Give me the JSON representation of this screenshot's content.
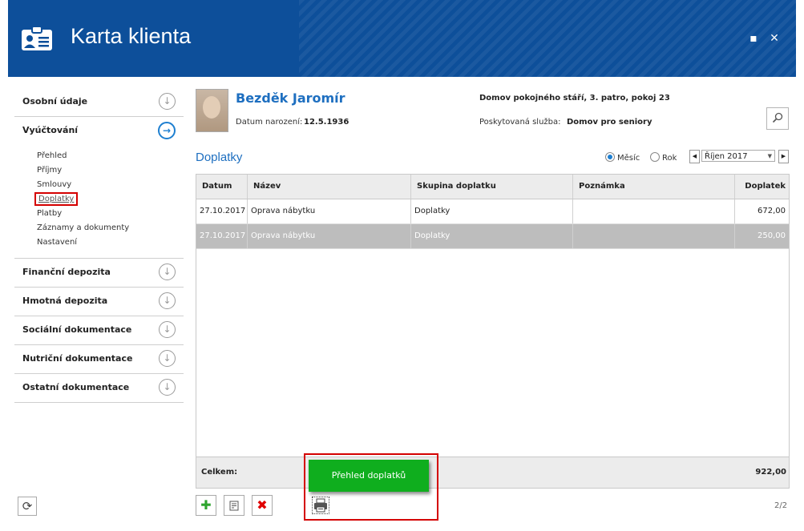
{
  "window": {
    "title": "Karta klienta",
    "maximize_glyph": "▪",
    "close_glyph": "✕"
  },
  "sidebar": {
    "sections": [
      {
        "label": "Osobní údaje",
        "icon": "arrow-down-circle-icon"
      },
      {
        "label": "Vyúčtování",
        "icon": "arrow-right-circle-icon",
        "active": true
      },
      {
        "label": "Finanční depozita",
        "icon": "arrow-down-circle-icon"
      },
      {
        "label": "Hmotná depozita",
        "icon": "arrow-down-circle-icon"
      },
      {
        "label": "Sociální dokumentace",
        "icon": "arrow-down-circle-icon"
      },
      {
        "label": "Nutriční dokumentace",
        "icon": "arrow-down-circle-icon"
      },
      {
        "label": "Ostatní dokumentace",
        "icon": "arrow-down-circle-icon"
      }
    ],
    "subitems": [
      "Přehled",
      "Příjmy",
      "Smlouvy",
      "Doplatky",
      "Platby",
      "Záznamy a dokumenty",
      "Nastavení"
    ],
    "selected_subitem": "Doplatky"
  },
  "client": {
    "name": "Bezděk Jaromír",
    "dob_label": "Datum narození:",
    "dob_value": "12.5.1936",
    "home": "Domov pokojného stáří, 3. patro, pokoj 23",
    "service_label": "Poskytovaná služba:",
    "service_value": "Domov pro seniory"
  },
  "section": {
    "title": "Doplatky",
    "radio_month": "Měsíc",
    "radio_year": "Rok",
    "radio_selected": "Měsíc",
    "period_value": "Říjen 2017",
    "prev_glyph": "◀",
    "next_glyph": "▶",
    "dropdown_glyph": "▼"
  },
  "table": {
    "columns": [
      "Datum",
      "Název",
      "Skupina doplatku",
      "Poznámka",
      "Doplatek"
    ],
    "rows": [
      [
        "27.10.2017",
        "Oprava nábytku",
        "Doplatky",
        "",
        "672,00"
      ],
      [
        "27.10.2017",
        "Oprava nábytku",
        "Doplatky",
        "",
        "250,00"
      ]
    ],
    "selected_row": 1,
    "total_label": "Celkem:",
    "total_value": "922,00"
  },
  "toolbar": {
    "add_glyph": "✚",
    "add_color": "#2ea52e",
    "delete_glyph": "✖",
    "delete_color": "#e00000",
    "tooltip": "Přehled doplatků"
  },
  "pager": "2/2",
  "colors": {
    "header": "#0d4f9a",
    "accent": "#1e6fc0",
    "tooltip": "#0fae1e",
    "highlight": "#d40000"
  }
}
